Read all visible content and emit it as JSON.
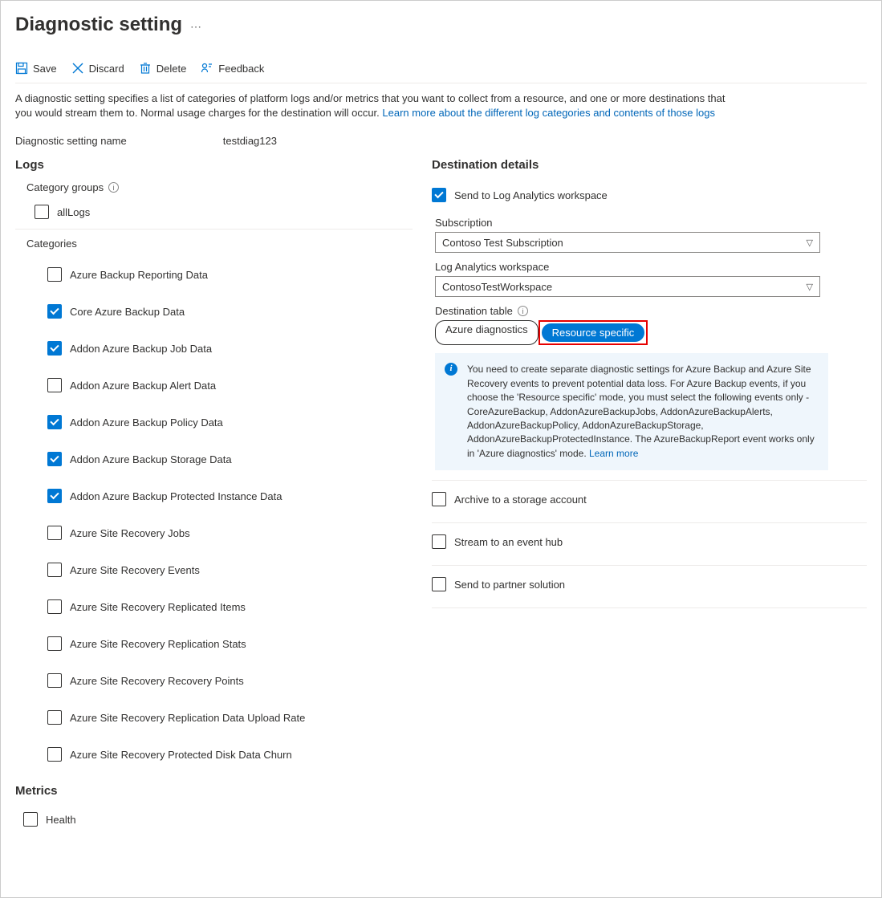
{
  "header": {
    "title": "Diagnostic setting"
  },
  "toolbar": {
    "save": "Save",
    "discard": "Discard",
    "delete": "Delete",
    "feedback": "Feedback"
  },
  "description": {
    "text": "A diagnostic setting specifies a list of categories of platform logs and/or metrics that you want to collect from a resource, and one or more destinations that you would stream them to. Normal usage charges for the destination will occur. ",
    "link": "Learn more about the different log categories and contents of those logs"
  },
  "name_field": {
    "label": "Diagnostic setting name",
    "value": "testdiag123"
  },
  "logs": {
    "heading": "Logs",
    "category_groups_label": "Category groups",
    "all_logs": "allLogs",
    "categories_label": "Categories",
    "categories": [
      {
        "label": "Azure Backup Reporting Data",
        "checked": false
      },
      {
        "label": "Core Azure Backup Data",
        "checked": true
      },
      {
        "label": "Addon Azure Backup Job Data",
        "checked": true
      },
      {
        "label": "Addon Azure Backup Alert Data",
        "checked": false
      },
      {
        "label": "Addon Azure Backup Policy Data",
        "checked": true
      },
      {
        "label": "Addon Azure Backup Storage Data",
        "checked": true
      },
      {
        "label": "Addon Azure Backup Protected Instance Data",
        "checked": true
      },
      {
        "label": "Azure Site Recovery Jobs",
        "checked": false
      },
      {
        "label": "Azure Site Recovery Events",
        "checked": false
      },
      {
        "label": "Azure Site Recovery Replicated Items",
        "checked": false
      },
      {
        "label": "Azure Site Recovery Replication Stats",
        "checked": false
      },
      {
        "label": "Azure Site Recovery Recovery Points",
        "checked": false
      },
      {
        "label": "Azure Site Recovery Replication Data Upload Rate",
        "checked": false
      },
      {
        "label": "Azure Site Recovery Protected Disk Data Churn",
        "checked": false
      }
    ]
  },
  "metrics": {
    "heading": "Metrics",
    "health": "Health"
  },
  "destination": {
    "heading": "Destination details",
    "send_la": "Send to Log Analytics workspace",
    "subscription_label": "Subscription",
    "subscription_value": "Contoso Test Subscription",
    "workspace_label": "Log Analytics workspace",
    "workspace_value": "ContosoTestWorkspace",
    "dest_table_label": "Destination table",
    "toggle_left": "Azure diagnostics",
    "toggle_right": "Resource specific",
    "info_text": "You need to create separate diagnostic settings for Azure Backup and Azure Site Recovery events to prevent potential data loss. For Azure Backup events, if you choose the 'Resource specific' mode, you must select the following events only - CoreAzureBackup, AddonAzureBackupJobs, AddonAzureBackupAlerts, AddonAzureBackupPolicy, AddonAzureBackupStorage, AddonAzureBackupProtectedInstance. The AzureBackupReport event works only in 'Azure diagnostics' mode.  ",
    "info_link": "Learn more",
    "archive": "Archive to a storage account",
    "stream": "Stream to an event hub",
    "partner": "Send to partner solution"
  }
}
